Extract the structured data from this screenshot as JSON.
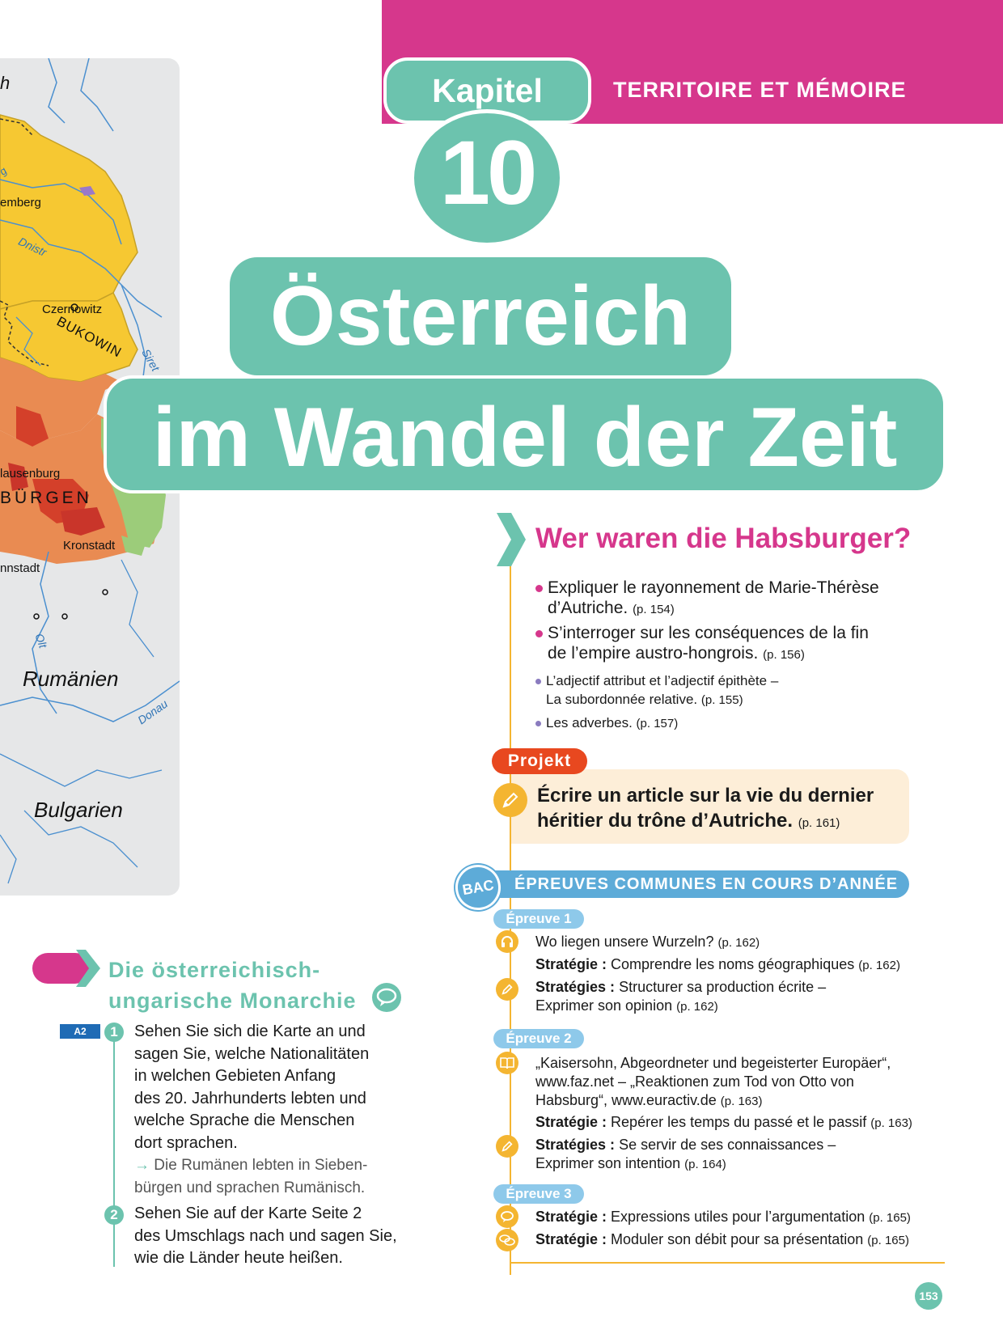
{
  "header": {
    "section_title": "TERRITOIRE ET MÉMOIRE",
    "chapter_label": "Kapitel",
    "chapter_number": "10"
  },
  "title": {
    "line1": "Österreich",
    "line2": "im Wandel der Zeit"
  },
  "map": {
    "labels": {
      "top_fragment": "h",
      "lemberg": "emberg",
      "czernowitz": "Czernowitz",
      "bukowina": "BUKOWIN",
      "klausenburg": "lausenburg",
      "siebenbuergen": "BÜRGEN",
      "kronstadt": "Kronstadt",
      "hermannstadt": "nnstadt",
      "rumaenien": "Rumänien",
      "bulgarien": "Bulgarien",
      "partial_g": "g"
    },
    "rivers": {
      "dnistr": "Dnistr",
      "siret": "Siret",
      "olt": "Olt",
      "donau": "Donau"
    }
  },
  "wer": {
    "heading": "Wer waren die Habsburger?",
    "objectives": [
      {
        "text1": "Expliquer le rayonnement de Marie-Thérèse",
        "text2": "d’Autriche.",
        "ref": "(p. 154)"
      },
      {
        "text1": "S’interroger sur les conséquences de la fin",
        "text2": "de l’empire austro-hongrois.",
        "ref": "(p. 156)"
      },
      {
        "text1": "L’adjectif attribut et l’adjectif épithète –",
        "text2": "La subordonnée relative.",
        "ref": "(p. 155)"
      },
      {
        "text1": "Les adverbes.",
        "text2": "",
        "ref": "(p. 157)"
      }
    ],
    "colors": {
      "magenta": "#d6378c",
      "violet": "#8a7bbf"
    }
  },
  "projekt": {
    "badge": "Projekt",
    "line1": "Écrire un article sur la vie du dernier",
    "line2": "héritier du trône d’Autriche.",
    "ref": "(p. 161)"
  },
  "bac": {
    "badge": "BAC",
    "title": "ÉPREUVES COMMUNES EN COURS D’ANNÉE",
    "epreuves": [
      {
        "label": "Épreuve 1",
        "items": [
          {
            "icon": "headphones-icon",
            "bold": "",
            "text": "Wo liegen unsere Wurzeln?",
            "text2": "",
            "ref": "(p. 162)"
          },
          {
            "icon": "",
            "bold": "Stratégie :",
            "text": "Comprendre les noms géographiques",
            "text2": "",
            "ref": "(p. 162)"
          },
          {
            "icon": "pencil-icon",
            "bold": "Stratégies :",
            "text": "Structurer sa production écrite –",
            "text2": "Exprimer son opinion",
            "ref": "(p. 162)"
          }
        ]
      },
      {
        "label": "Épreuve 2",
        "items": [
          {
            "icon": "book-icon",
            "bold": "",
            "text": "„Kaisersohn, Abgeordneter und begeisterter Europäer“,",
            "text2": "www.faz.net – „Reaktionen zum Tod von Otto von",
            "text3": "Habsburg“, www.euractiv.de",
            "ref": "(p. 163)"
          },
          {
            "icon": "",
            "bold": "Stratégie :",
            "text": "Repérer les temps du passé et le passif",
            "text2": "",
            "ref": "(p. 163)"
          },
          {
            "icon": "pencil-icon",
            "bold": "Stratégies :",
            "text": "Se servir de ses connaissances –",
            "text2": "Exprimer son intention",
            "ref": "(p. 164)"
          }
        ]
      },
      {
        "label": "Épreuve 3",
        "items": [
          {
            "icon": "speech-bubble-icon",
            "bold": "Stratégie :",
            "text": "Expressions utiles pour l’argumentation",
            "text2": "",
            "ref": "(p. 165)"
          },
          {
            "icon": "dialogue-icon",
            "bold": "Stratégie :",
            "text": "Moduler son débit pour sa présentation",
            "text2": "",
            "ref": "(p. 165)"
          }
        ]
      }
    ]
  },
  "monarchie": {
    "title_line1": "Die österreichisch-",
    "title_line2": "ungarische Monarchie",
    "level": "A2",
    "tasks": [
      {
        "number": "1",
        "lines": [
          "Sehen Sie sich die Karte an und",
          "sagen Sie, welche Nationalitäten",
          "in welchen Gebieten Anfang",
          "des 20. Jahrhunderts lebten und",
          "welche Sprache die Menschen",
          "dort sprachen."
        ],
        "hint_arrow": "→",
        "hint_lines": [
          "Die Rumänen lebten in Sieben-",
          "bürgen und sprachen Rumänisch."
        ]
      },
      {
        "number": "2",
        "lines": [
          "Sehen Sie auf der Karte Seite 2",
          "des Umschlags nach und sagen Sie,",
          "wie die Länder heute heißen."
        ]
      }
    ]
  },
  "page_number": "153",
  "theme": {
    "teal": "#6cc3ae",
    "magenta": "#d6378c",
    "orange": "#e8481f",
    "yellow": "#f4b531",
    "blue": "#5dabd8"
  }
}
